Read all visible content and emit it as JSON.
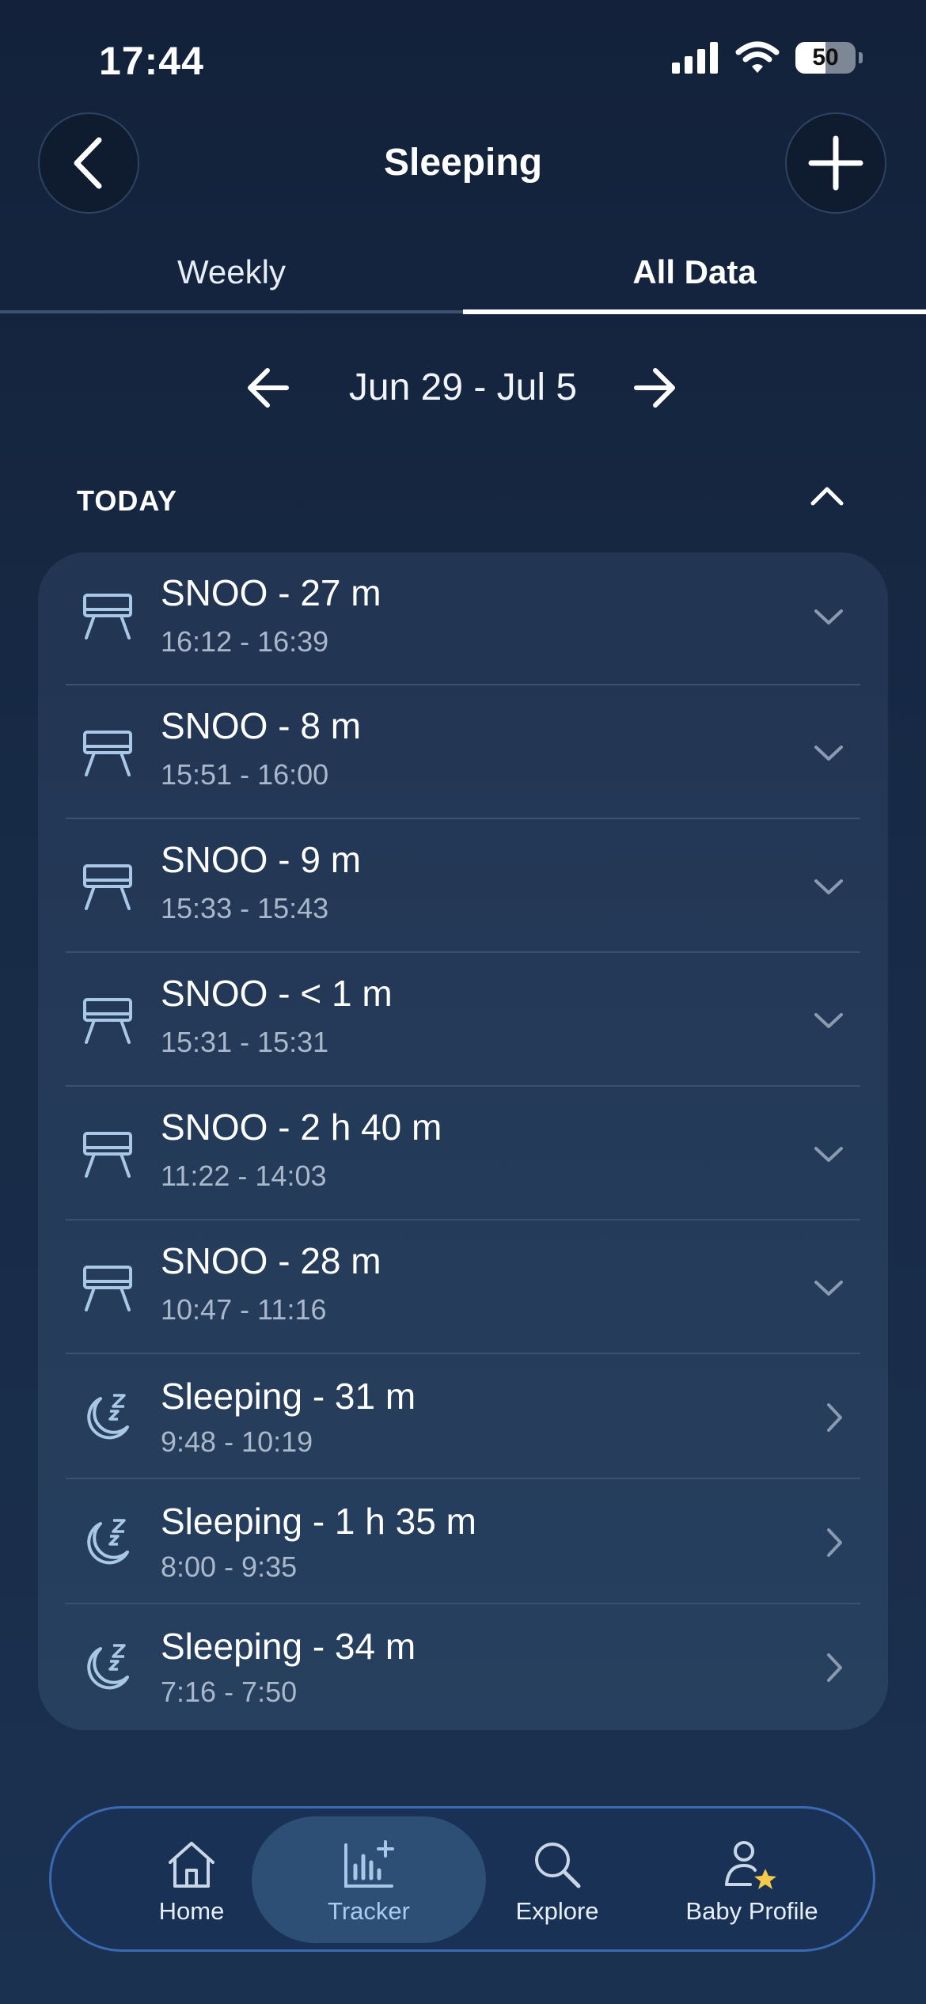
{
  "status_bar": {
    "time": "17:44",
    "battery": "50"
  },
  "header": {
    "title": "Sleeping"
  },
  "tabs": [
    {
      "label": "Weekly",
      "active": false
    },
    {
      "label": "All Data",
      "active": true
    }
  ],
  "date_nav": {
    "range": "Jun 29 - Jul 5"
  },
  "section": {
    "label": "TODAY"
  },
  "entries": [
    {
      "type": "snoo",
      "title": "SNOO - 27 m",
      "time": "16:12 - 16:39",
      "action": "expand"
    },
    {
      "type": "snoo",
      "title": "SNOO - 8 m",
      "time": "15:51 - 16:00",
      "action": "expand"
    },
    {
      "type": "snoo",
      "title": "SNOO - 9 m",
      "time": "15:33 - 15:43",
      "action": "expand"
    },
    {
      "type": "snoo",
      "title": "SNOO - < 1 m",
      "time": "15:31 - 15:31",
      "action": "expand"
    },
    {
      "type": "snoo",
      "title": "SNOO - 2 h 40 m",
      "time": "11:22 - 14:03",
      "action": "expand"
    },
    {
      "type": "snoo",
      "title": "SNOO - 28 m",
      "time": "10:47 - 11:16",
      "action": "expand"
    },
    {
      "type": "sleep",
      "title": "Sleeping - 31 m",
      "time": "9:48 - 10:19",
      "action": "open"
    },
    {
      "type": "sleep",
      "title": "Sleeping - 1 h 35 m",
      "time": "8:00 - 9:35",
      "action": "open"
    },
    {
      "type": "sleep",
      "title": "Sleeping - 34 m",
      "time": "7:16 - 7:50",
      "action": "open"
    }
  ],
  "nav": [
    {
      "label": "Home",
      "icon": "home-icon",
      "active": false
    },
    {
      "label": "Tracker",
      "icon": "tracker-icon",
      "active": true
    },
    {
      "label": "Explore",
      "icon": "search-icon",
      "active": false
    },
    {
      "label": "Baby Profile",
      "icon": "baby-profile-icon",
      "active": false
    }
  ],
  "colors": {
    "background": "#13213a",
    "card": "#223553",
    "accent": "#3b6ab3",
    "icon": "#a9c8e8"
  }
}
